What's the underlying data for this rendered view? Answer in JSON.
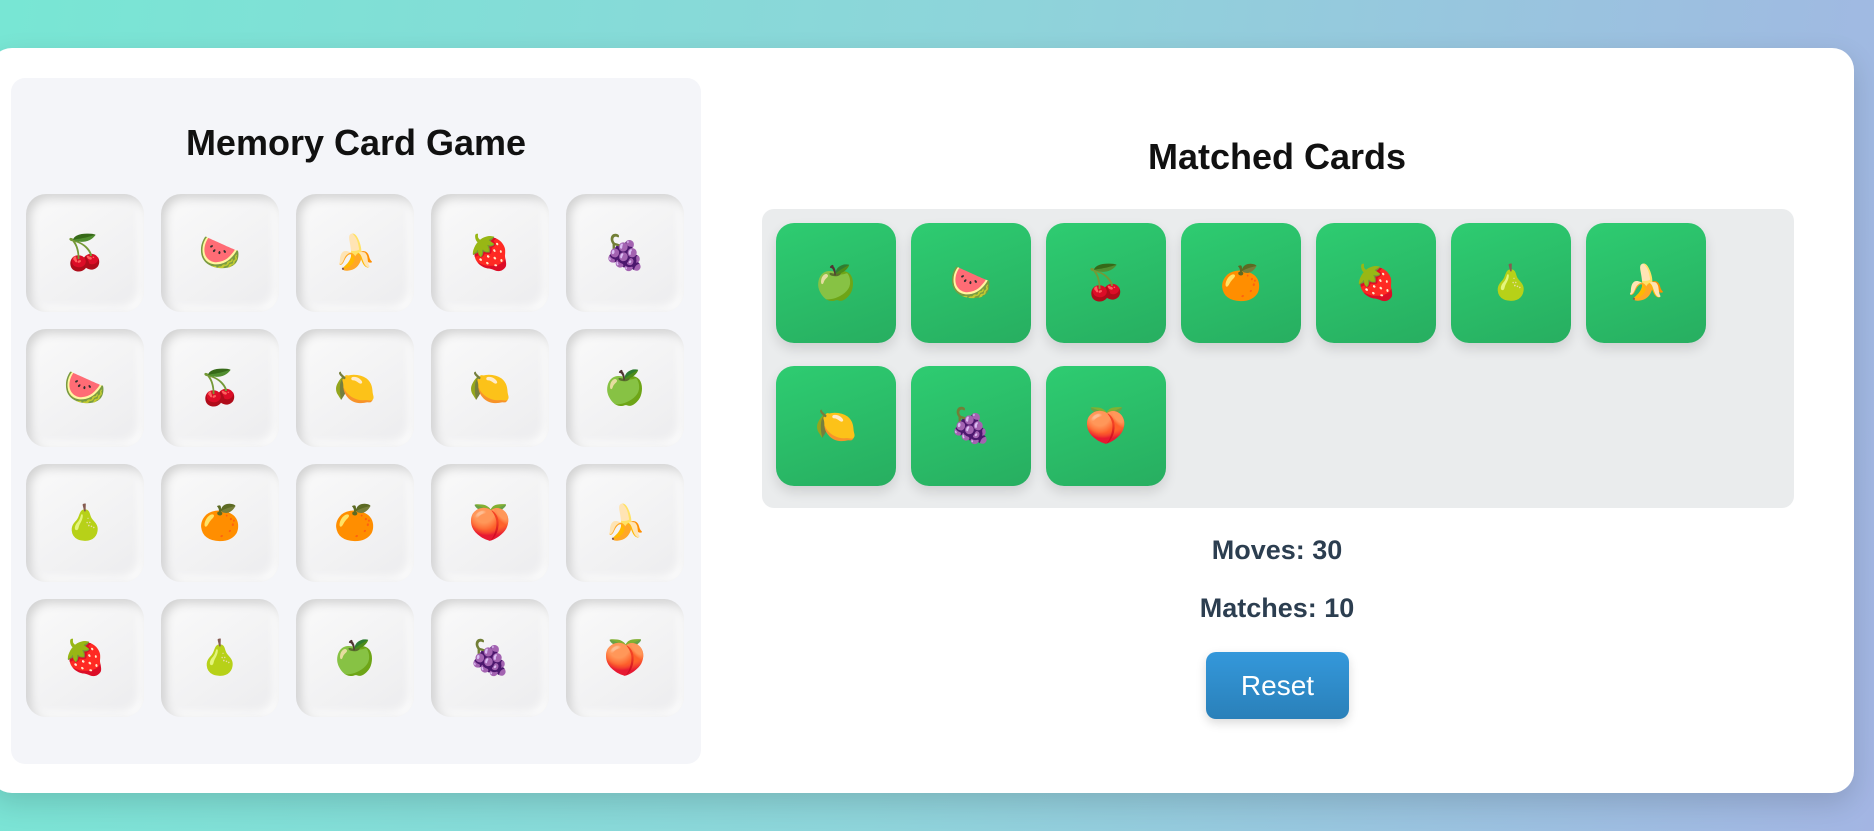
{
  "game": {
    "title": "Memory Card Game",
    "cards": [
      {
        "fruit": "🍒"
      },
      {
        "fruit": "🍉"
      },
      {
        "fruit": "🍌"
      },
      {
        "fruit": "🍓"
      },
      {
        "fruit": "🍇"
      },
      {
        "fruit": "🍉"
      },
      {
        "fruit": "🍒"
      },
      {
        "fruit": "🍋"
      },
      {
        "fruit": "🍋"
      },
      {
        "fruit": "🍏"
      },
      {
        "fruit": "🍐"
      },
      {
        "fruit": "🍊"
      },
      {
        "fruit": "🍊"
      },
      {
        "fruit": "🍑"
      },
      {
        "fruit": "🍌"
      },
      {
        "fruit": "🍓"
      },
      {
        "fruit": "🍐"
      },
      {
        "fruit": "🍏"
      },
      {
        "fruit": "🍇"
      },
      {
        "fruit": "🍑"
      }
    ]
  },
  "matched": {
    "title": "Matched Cards",
    "cards": [
      {
        "fruit": "🍏"
      },
      {
        "fruit": "🍉"
      },
      {
        "fruit": "🍒"
      },
      {
        "fruit": "🍊"
      },
      {
        "fruit": "🍓"
      },
      {
        "fruit": "🍐"
      },
      {
        "fruit": "🍌"
      },
      {
        "fruit": "🍋"
      },
      {
        "fruit": "🍇"
      },
      {
        "fruit": "🍑"
      }
    ]
  },
  "stats": {
    "moves_text": "Moves: 30",
    "matches_text": "Matches: 10"
  },
  "reset_label": "Reset",
  "colors": {
    "matched_card": "#2ecc71",
    "reset_button": "#3498db",
    "stat_text": "#2c3e50"
  }
}
